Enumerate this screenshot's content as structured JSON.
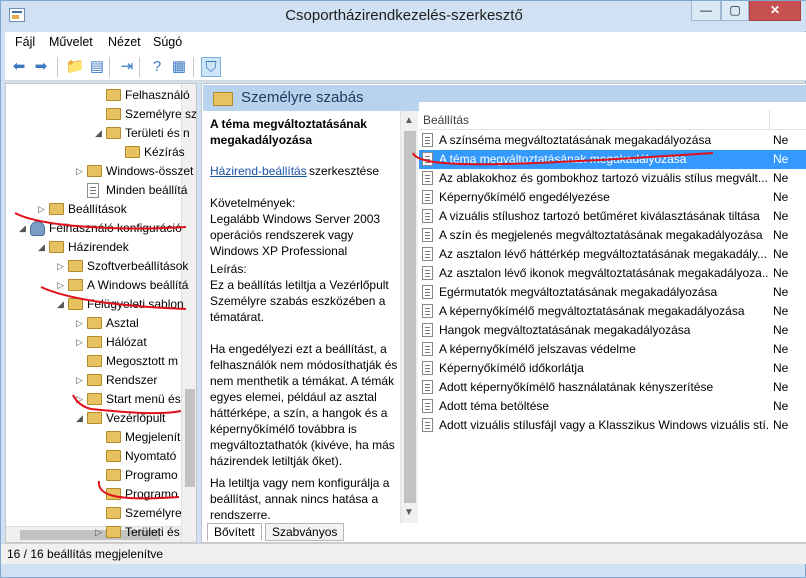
{
  "window": {
    "title": "Csoportházirendkezelés-szerkesztő",
    "min": "—",
    "max": "▢",
    "close": "✕"
  },
  "menu": [
    "Fájl",
    "Művelet",
    "Nézet",
    "Súgó"
  ],
  "toolbar": [
    {
      "icon": "back-arrow-icon",
      "glyph": "⬅"
    },
    {
      "icon": "forward-arrow-icon",
      "glyph": "➡"
    },
    {
      "icon": "up-folder-icon",
      "glyph": "📁"
    },
    {
      "icon": "show-hide-tree-icon",
      "glyph": "▤"
    },
    {
      "icon": "export-list-icon",
      "glyph": "⇥"
    },
    {
      "icon": "help-icon",
      "glyph": "?"
    },
    {
      "icon": "properties-icon",
      "glyph": "▦"
    },
    {
      "icon": "filter-icon",
      "glyph": "⛉"
    }
  ],
  "tree": [
    {
      "label": "Felhasználó",
      "indent": 5,
      "icon": "folder",
      "exp": ""
    },
    {
      "label": "Személyre sz",
      "indent": 5,
      "icon": "folder",
      "exp": ""
    },
    {
      "label": "Területi és n",
      "indent": 5,
      "icon": "folder",
      "exp": "◢"
    },
    {
      "label": "Kézírás",
      "indent": 6,
      "icon": "folder",
      "exp": ""
    },
    {
      "label": "Windows-összet",
      "indent": 4,
      "icon": "folder",
      "exp": "▷"
    },
    {
      "label": "Minden beállítá",
      "indent": 4,
      "icon": "policy",
      "exp": ""
    },
    {
      "label": "Beállítások",
      "indent": 2,
      "icon": "folder",
      "exp": "▷"
    },
    {
      "label": "Felhasználó konfiguráció",
      "indent": 1,
      "icon": "user",
      "exp": "◢"
    },
    {
      "label": "Házirendek",
      "indent": 2,
      "icon": "folder",
      "exp": "◢"
    },
    {
      "label": "Szoftverbeállítások",
      "indent": 3,
      "icon": "folder",
      "exp": "▷"
    },
    {
      "label": "A Windows beállítá",
      "indent": 3,
      "icon": "folder",
      "exp": "▷"
    },
    {
      "label": "Felügyeleti sablon",
      "indent": 3,
      "icon": "folder",
      "exp": "◢"
    },
    {
      "label": "Asztal",
      "indent": 4,
      "icon": "folder",
      "exp": "▷"
    },
    {
      "label": "Hálózat",
      "indent": 4,
      "icon": "folder",
      "exp": "▷"
    },
    {
      "label": "Megosztott m",
      "indent": 4,
      "icon": "folder",
      "exp": ""
    },
    {
      "label": "Rendszer",
      "indent": 4,
      "icon": "folder",
      "exp": "▷"
    },
    {
      "label": "Start menü és",
      "indent": 4,
      "icon": "folder",
      "exp": "▷"
    },
    {
      "label": "Vezérlőpult",
      "indent": 4,
      "icon": "folder",
      "exp": "◢"
    },
    {
      "label": "Megjelenít",
      "indent": 5,
      "icon": "folder",
      "exp": ""
    },
    {
      "label": "Nyomtató",
      "indent": 5,
      "icon": "folder",
      "exp": ""
    },
    {
      "label": "Programo",
      "indent": 5,
      "icon": "folder",
      "exp": ""
    },
    {
      "label": "Programo",
      "indent": 5,
      "icon": "folder",
      "exp": ""
    },
    {
      "label": "Személyre",
      "indent": 5,
      "icon": "folder",
      "exp": ""
    },
    {
      "label": "Területi és",
      "indent": 5,
      "icon": "folder",
      "exp": "▷"
    }
  ],
  "section": {
    "title": "Személyre szabás"
  },
  "description": {
    "title": "A téma megváltoztatásának megakadályozása",
    "link": "Házirend-beállítás",
    "link_suffix": "szerkesztése",
    "requirements": "Követelmények:\nLegalább Windows Server 2003 operációs rendszerek vagy Windows XP Professional",
    "desc1": "Leírás:\nEz a beállítás letiltja a Vezérlőpult Személyre szabás eszközében a tématárat.",
    "desc2": "Ha engedélyezi ezt a beállítást, a felhasználók nem módosíthatják és nem menthetik a témákat. A témák egyes elemei, például az asztal háttérképe, a szín, a hangok és a képernyőkímélő továbbra is megváltoztathatók (kivéve, ha más házirendek letiltják őket).",
    "desc3": "Ha letiltja vagy nem konfigurálja a beállítást, annak nincs hatása a rendszerre."
  },
  "list": {
    "header": "Beállítás",
    "state_col_value": "Ne",
    "selected_index": 1,
    "rows": [
      "A színséma megváltoztatásának megakadályozása",
      "A téma megváltoztatásának megakadályozása",
      "Az ablakokhoz és gombokhoz tartozó vizuális stílus megvált...",
      "Képernyőkímélő engedélyezése",
      "A vizuális stílushoz tartozó betűméret kiválasztásának tiltása",
      "A szín és megjelenés megváltoztatásának megakadályozása",
      "Az asztalon lévő háttérkép megváltoztatásának megakadály...",
      "Az asztalon lévő ikonok megváltoztatásának megakadályoza...",
      "Egérmutatók megváltoztatásának megakadályozása",
      "A képernyőkímélő megváltoztatásának megakadályozása",
      "Hangok megváltoztatásának megakadályozása",
      "A képernyőkímélő jelszavas védelme",
      "Képernyőkímélő időkorlátja",
      "Adott képernyőkímélő használatának kényszerítése",
      "Adott téma betöltése",
      "Adott vizuális stílusfájl vagy a Klasszikus Windows vizuális stí..."
    ]
  },
  "tabs": [
    "Bővített",
    "Szabványos"
  ],
  "status": "16 / 16 beállítás megjelenítve",
  "colors": {
    "selection": "#3399ff",
    "header": "#b9d3ee",
    "annotation": "#e0101a",
    "title_bg": "#cfe1f3"
  }
}
